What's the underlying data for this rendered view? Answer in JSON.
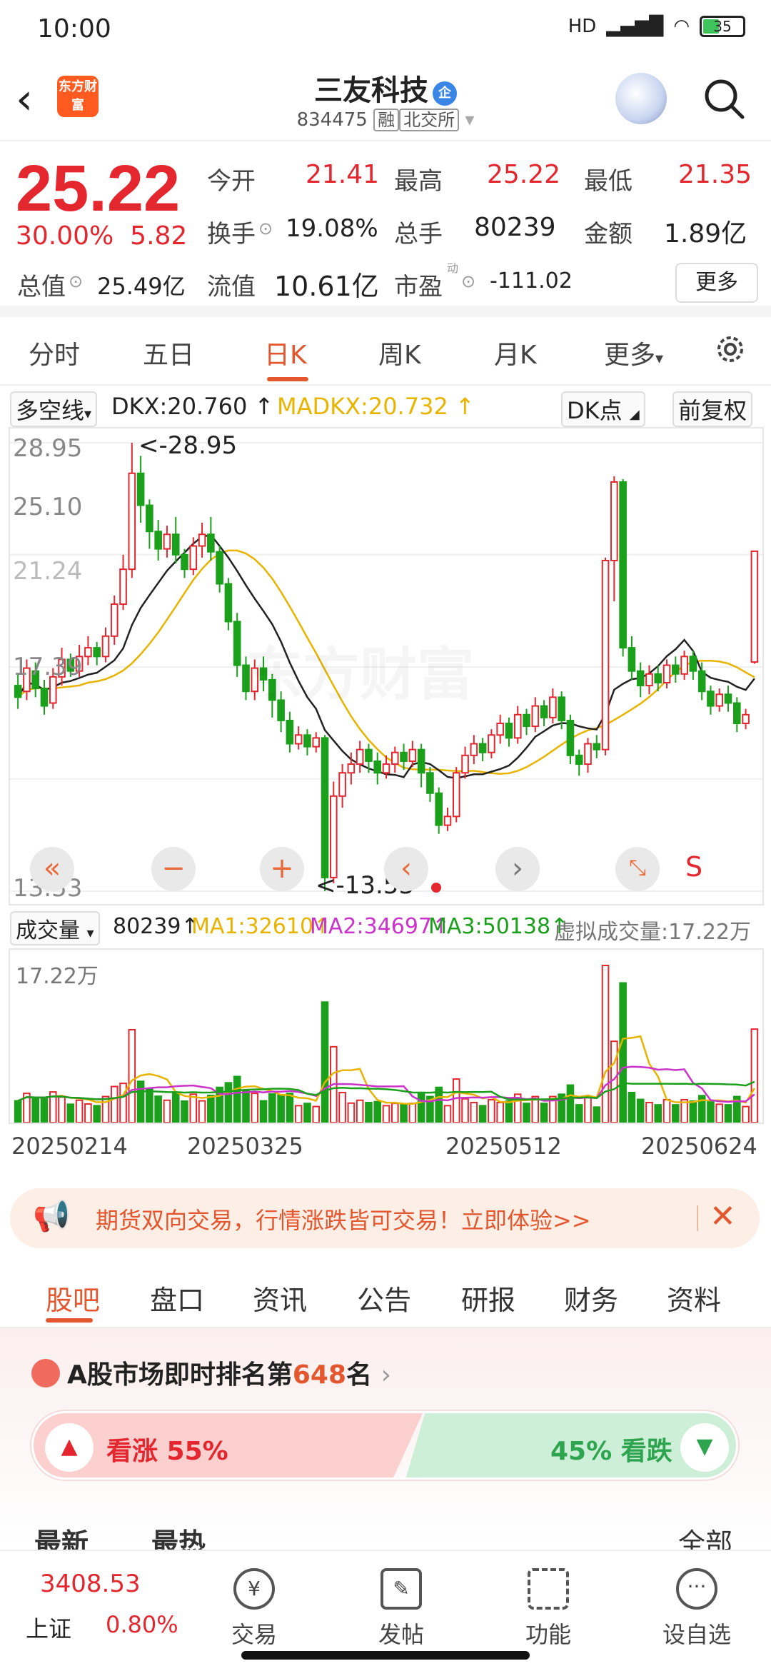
{
  "status_bar": {
    "time": "10:00",
    "network": "HD",
    "battery": "35"
  },
  "header": {
    "back_icon": "back-arrow-icon",
    "logo_text": "东方财富",
    "stock_name": "三友科技",
    "badge": "企",
    "code": "834475",
    "tags": [
      "融",
      "北交所"
    ]
  },
  "quote": {
    "price": "25.22",
    "pct": "30.00%",
    "change": "5.82",
    "open_label": "今开",
    "open": "21.41",
    "high_label": "最高",
    "high": "25.22",
    "low_label": "最低",
    "low": "21.35",
    "turnover_label": "换手",
    "turnover": "19.08%",
    "volume_label": "总手",
    "volume": "80239",
    "amount_label": "金额",
    "amount": "1.89亿",
    "mcap_label": "总值",
    "mcap": "25.49亿",
    "float_label": "流值",
    "float": "10.61亿",
    "pe_label": "市盈",
    "pe_sup": "动",
    "pe": "-111.02",
    "more": "更多"
  },
  "period_tabs": [
    "分时",
    "五日",
    "日K",
    "周K",
    "月K",
    "更多"
  ],
  "active_period": "日K",
  "indicator": {
    "name": "多空线",
    "dkx": "DKX:20.760",
    "madkx": "MADKX:20.732",
    "dk_btn": "DK点",
    "adjust": "前复权",
    "colors": {
      "dkx": "#222222",
      "madkx": "#e8b400"
    }
  },
  "chart_data": {
    "type": "candlestick",
    "y_ticks": [
      "28.95",
      "25.10",
      "21.24",
      "17.39",
      "13.53"
    ],
    "ylim": [
      13.53,
      28.95
    ],
    "high_marker": "<-28.95",
    "low_marker": "<-13.53",
    "watermark": "东方财富",
    "x_ticks": [
      "20250214",
      "20250325",
      "20250512",
      "20250624"
    ],
    "up_color": "#e4262f",
    "down_color": "#1aa01a",
    "candles": [
      [
        20.6,
        20.2,
        21.0,
        19.8
      ],
      [
        20.4,
        21.2,
        21.5,
        20.1
      ],
      [
        21.1,
        20.5,
        21.4,
        20.2
      ],
      [
        20.5,
        19.9,
        20.8,
        19.6
      ],
      [
        20.0,
        20.9,
        21.2,
        19.8
      ],
      [
        20.9,
        21.5,
        21.9,
        20.6
      ],
      [
        21.5,
        21.1,
        21.7,
        20.9
      ],
      [
        21.1,
        21.6,
        22.0,
        20.9
      ],
      [
        21.6,
        21.9,
        22.3,
        21.3
      ],
      [
        21.9,
        21.6,
        22.1,
        21.3
      ],
      [
        21.6,
        22.3,
        22.6,
        21.4
      ],
      [
        22.3,
        23.4,
        23.7,
        22.0
      ],
      [
        23.4,
        24.6,
        25.1,
        23.2
      ],
      [
        24.6,
        27.9,
        28.95,
        24.3
      ],
      [
        27.9,
        26.8,
        28.5,
        26.2
      ],
      [
        26.8,
        25.9,
        27.0,
        25.3
      ],
      [
        25.9,
        25.3,
        26.3,
        24.9
      ],
      [
        25.3,
        25.8,
        26.1,
        25.0
      ],
      [
        25.8,
        25.1,
        26.4,
        24.8
      ],
      [
        25.1,
        24.6,
        25.3,
        24.3
      ],
      [
        24.6,
        25.4,
        25.7,
        24.4
      ],
      [
        25.4,
        25.8,
        26.2,
        25.0
      ],
      [
        25.8,
        25.2,
        26.4,
        24.9
      ],
      [
        25.2,
        24.1,
        25.4,
        23.8
      ],
      [
        24.1,
        22.8,
        24.3,
        22.5
      ],
      [
        22.8,
        21.3,
        23.1,
        20.9
      ],
      [
        21.3,
        20.4,
        21.6,
        20.1
      ],
      [
        20.4,
        21.2,
        21.5,
        20.1
      ],
      [
        21.2,
        20.8,
        21.6,
        20.4
      ],
      [
        20.8,
        20.1,
        21.0,
        19.5
      ],
      [
        20.1,
        19.4,
        20.4,
        19.0
      ],
      [
        19.4,
        18.6,
        19.7,
        18.3
      ],
      [
        18.6,
        18.9,
        19.2,
        18.4
      ],
      [
        18.9,
        18.5,
        19.1,
        18.2
      ],
      [
        18.5,
        18.8,
        19.0,
        18.3
      ],
      [
        18.8,
        14.0,
        18.9,
        13.53
      ],
      [
        14.0,
        16.8,
        17.3,
        13.8
      ],
      [
        16.8,
        17.6,
        17.9,
        16.4
      ],
      [
        17.6,
        17.9,
        18.3,
        17.2
      ],
      [
        17.9,
        18.4,
        18.7,
        17.6
      ],
      [
        18.4,
        18.0,
        18.6,
        17.6
      ],
      [
        18.0,
        17.6,
        18.3,
        17.2
      ],
      [
        17.6,
        17.9,
        18.2,
        17.4
      ],
      [
        17.9,
        18.3,
        18.5,
        17.6
      ],
      [
        18.3,
        18.0,
        18.6,
        17.7
      ],
      [
        18.0,
        18.4,
        18.7,
        17.8
      ],
      [
        18.4,
        17.6,
        18.6,
        17.1
      ],
      [
        17.6,
        16.9,
        17.8,
        16.6
      ],
      [
        16.9,
        15.8,
        17.1,
        15.5
      ],
      [
        15.8,
        16.1,
        16.4,
        15.6
      ],
      [
        16.1,
        17.6,
        17.8,
        15.9
      ],
      [
        17.6,
        18.2,
        18.5,
        17.4
      ],
      [
        18.2,
        18.6,
        18.9,
        17.9
      ],
      [
        18.6,
        18.3,
        18.8,
        18.0
      ],
      [
        18.3,
        18.9,
        19.1,
        18.1
      ],
      [
        18.9,
        19.3,
        19.6,
        18.6
      ],
      [
        19.3,
        18.8,
        19.5,
        18.5
      ],
      [
        18.8,
        19.6,
        19.9,
        18.6
      ],
      [
        19.6,
        19.2,
        19.8,
        18.9
      ],
      [
        19.2,
        19.9,
        20.2,
        19.0
      ],
      [
        19.9,
        19.5,
        20.1,
        19.2
      ],
      [
        19.5,
        20.2,
        20.5,
        19.3
      ],
      [
        20.2,
        19.4,
        20.4,
        19.1
      ],
      [
        19.4,
        18.2,
        19.6,
        17.9
      ],
      [
        18.2,
        17.9,
        18.4,
        17.5
      ],
      [
        17.9,
        18.6,
        18.8,
        17.6
      ],
      [
        18.6,
        18.4,
        18.9,
        18.1
      ],
      [
        18.4,
        24.9,
        25.0,
        18.2
      ],
      [
        24.9,
        27.6,
        27.8,
        23.5
      ],
      [
        27.6,
        21.9,
        27.7,
        21.6
      ],
      [
        21.9,
        21.1,
        22.3,
        20.8
      ],
      [
        21.1,
        20.6,
        21.4,
        20.2
      ],
      [
        20.6,
        21.0,
        21.3,
        20.3
      ],
      [
        21.0,
        20.7,
        21.3,
        20.4
      ],
      [
        20.7,
        21.3,
        21.5,
        20.5
      ],
      [
        21.3,
        21.0,
        21.6,
        20.7
      ],
      [
        21.0,
        21.6,
        21.8,
        20.8
      ],
      [
        21.6,
        21.1,
        21.8,
        20.8
      ],
      [
        21.1,
        20.4,
        21.4,
        20.1
      ],
      [
        20.4,
        19.9,
        20.6,
        19.6
      ],
      [
        19.9,
        20.3,
        20.5,
        19.7
      ],
      [
        20.3,
        20.0,
        20.6,
        19.7
      ],
      [
        20.0,
        19.3,
        20.2,
        19.0
      ],
      [
        19.3,
        19.6,
        19.8,
        19.1
      ],
      [
        21.41,
        25.22,
        25.22,
        21.35
      ]
    ],
    "volume": {
      "label": "成交量",
      "current": "80239",
      "ma1": "MA1:32610",
      "ma2": "MA2:34697",
      "ma3": "MA3:50138",
      "virtual": "虚拟成交量:17.22万",
      "max_label": "17.22万",
      "colors": {
        "ma1": "#e8b400",
        "ma2": "#cc33cc",
        "ma3": "#1aa01a"
      }
    }
  },
  "chart_nav": [
    "double-left-icon",
    "minus-icon",
    "plus-icon",
    "left-icon",
    "right-icon",
    "expand-icon"
  ],
  "chart_s_label": "S",
  "banner": {
    "text": "期货双向交易，行情涨跌皆可交易！立即体验>>"
  },
  "content_tabs": [
    "股吧",
    "盘口",
    "资讯",
    "公告",
    "研报",
    "财务",
    "资料"
  ],
  "ranking": {
    "prefix": "A股市场即时排名第",
    "rank": "648",
    "suffix": "名"
  },
  "vote": {
    "up": "看涨 55%",
    "down": "45% 看跌"
  },
  "feed_tabs": [
    "最新",
    "最热",
    "全部"
  ],
  "bottom_nav": {
    "index_value": "3408.53",
    "index_name": "上证",
    "index_pct": "0.80%",
    "items": [
      "交易",
      "发帖",
      "功能",
      "设自选"
    ]
  }
}
